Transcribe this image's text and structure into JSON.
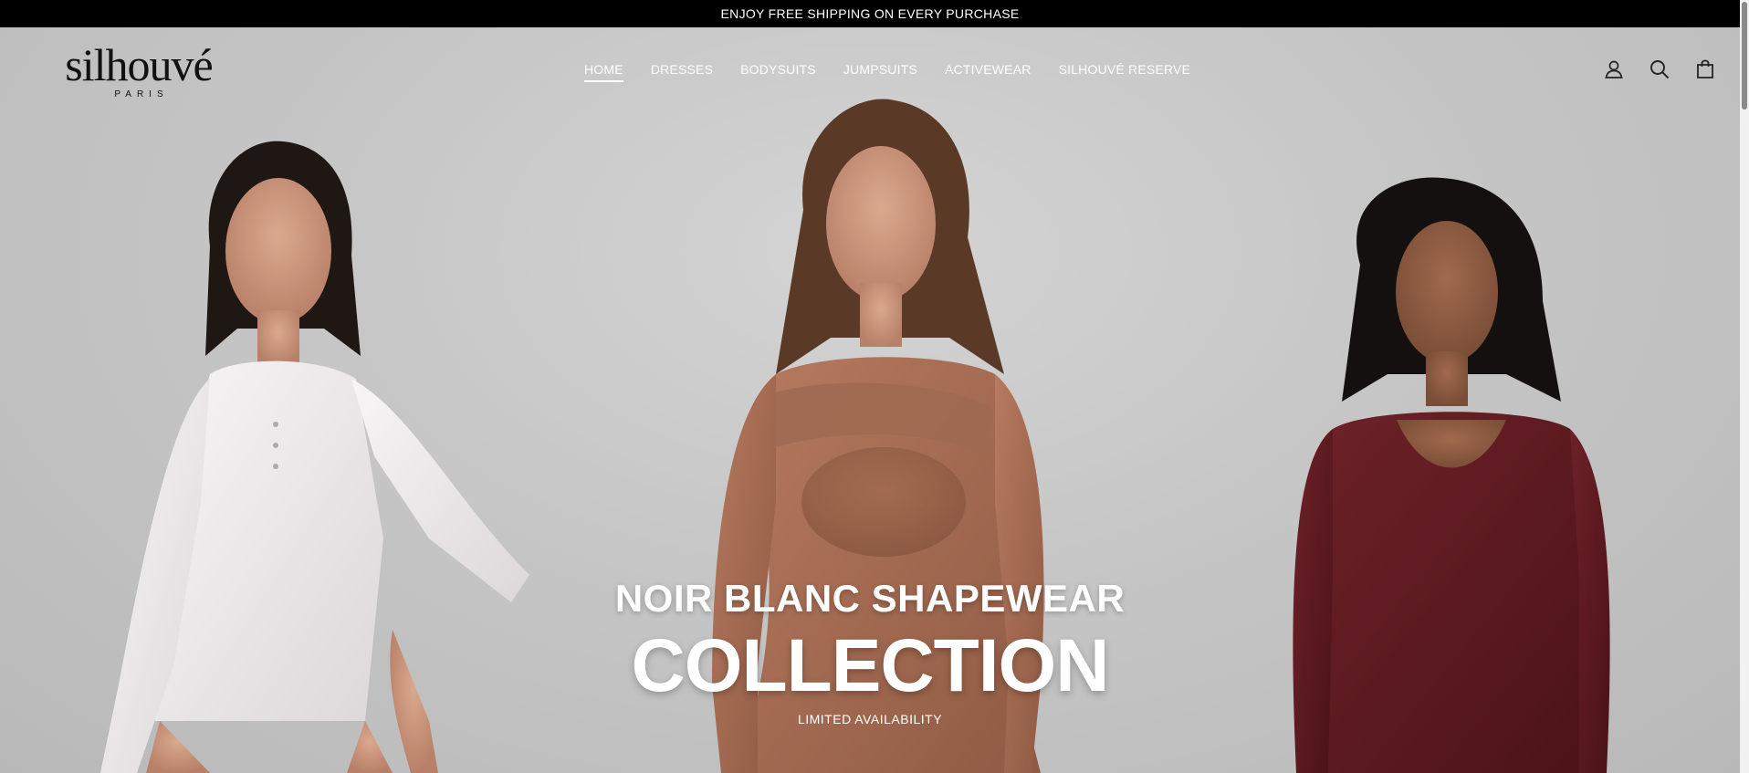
{
  "announcement": "ENJOY FREE SHIPPING ON EVERY PURCHASE",
  "logo": {
    "wordmark": "silhouvé",
    "sub": "PARIS"
  },
  "nav": {
    "items": [
      {
        "label": "HOME"
      },
      {
        "label": "DRESSES"
      },
      {
        "label": "BODYSUITS"
      },
      {
        "label": "JUMPSUITS"
      },
      {
        "label": "ACTIVEWEAR"
      },
      {
        "label": "SILHOUVÉ RESERVE"
      }
    ],
    "active": "HOME"
  },
  "header_icons": [
    "account-icon",
    "search-icon",
    "cart-icon"
  ],
  "hero": {
    "title": "NOIR BLANC SHAPEWEAR",
    "headline": "COLLECTION",
    "subtitle": "LIMITED AVAILABILITY"
  },
  "colors": {
    "announcement_bg": "#000000",
    "body_left": "#f1eff0",
    "body_center": "#a36a52",
    "body_right": "#5c1a1f"
  }
}
